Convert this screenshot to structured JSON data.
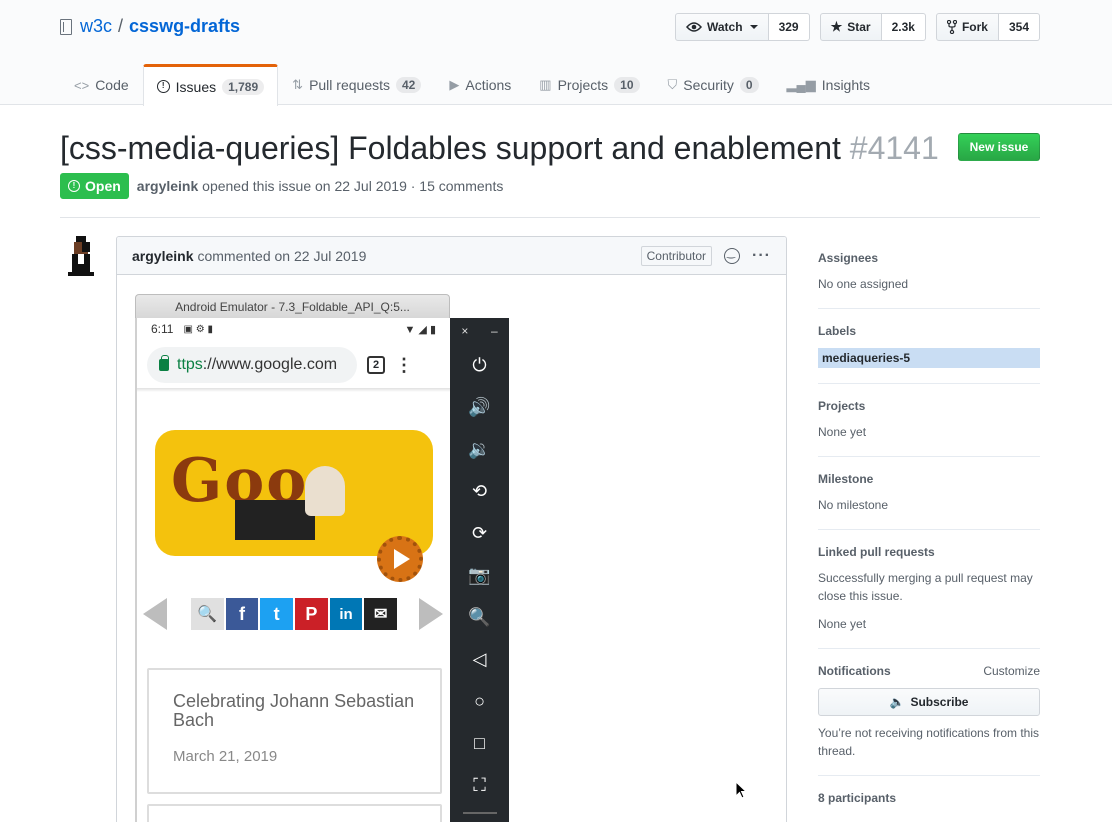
{
  "repo": {
    "owner": "w3c",
    "separator": "/",
    "name": "csswg-drafts",
    "icon": "repo-book-icon"
  },
  "actions": {
    "watch_label": "Watch",
    "watch_count": "329",
    "star_label": "Star",
    "star_count": "2.3k",
    "fork_label": "Fork",
    "fork_count": "354"
  },
  "nav": {
    "tabs": [
      {
        "label": "Code",
        "count": "",
        "icon": "code-icon"
      },
      {
        "label": "Issues",
        "count": "1,789",
        "icon": "issue-opened-icon"
      },
      {
        "label": "Pull requests",
        "count": "42",
        "icon": "git-pull-request-icon"
      },
      {
        "label": "Actions",
        "count": "",
        "icon": "play-icon"
      },
      {
        "label": "Projects",
        "count": "10",
        "icon": "project-icon"
      },
      {
        "label": "Security",
        "count": "0",
        "icon": "shield-icon"
      },
      {
        "label": "Insights",
        "count": "",
        "icon": "graph-icon"
      }
    ]
  },
  "issue": {
    "title": "[css-media-queries] Foldables support and enablement",
    "number": "#4141",
    "new_issue_label": "New issue",
    "state": "Open",
    "author": "argyleink",
    "meta_text": "opened this issue on 22 Jul 2019 · 15 comments"
  },
  "comment": {
    "author": "argyleink",
    "meta": "commented on 22 Jul 2019",
    "badge": "Contributor",
    "more": "···"
  },
  "emulator": {
    "window_title": "Android Emulator - 7.3_Foldable_API_Q:5...",
    "time": "6:11",
    "url_scheme": "ttps",
    "url_rest": "://www.google.com",
    "tab_count": "2",
    "doodle_text": "Goo",
    "share_search": "🔍",
    "share_fb": "f",
    "share_tw": "t",
    "share_pin": "P",
    "share_li": "in",
    "share_mail": "✉",
    "card_title": "Celebrating Johann Sebastian Bach",
    "card_date": "March 21, 2019",
    "win_close": "×",
    "win_min": "–",
    "controls": [
      "⏻",
      "🔊",
      "🔉",
      "⟲",
      "⟳",
      "📷",
      "🔍",
      "◁",
      "○",
      "□",
      "⛶"
    ]
  },
  "sidebar": {
    "assignees_head": "Assignees",
    "assignees_val": "No one assigned",
    "labels_head": "Labels",
    "label": "mediaqueries-5",
    "label_color": "#c9ddf3",
    "projects_head": "Projects",
    "projects_val": "None yet",
    "milestone_head": "Milestone",
    "milestone_val": "No milestone",
    "linked_head": "Linked pull requests",
    "linked_desc": "Successfully merging a pull request may close this issue.",
    "linked_val": "None yet",
    "notif_head": "Notifications",
    "notif_customize": "Customize",
    "subscribe_label": "Subscribe",
    "notif_desc": "You’re not receiving notifications from this thread.",
    "participants": "8 participants"
  },
  "colors": {
    "open_green": "#2cbe4e",
    "link_blue": "#0366d6",
    "selected_tab_border": "#e36209"
  }
}
